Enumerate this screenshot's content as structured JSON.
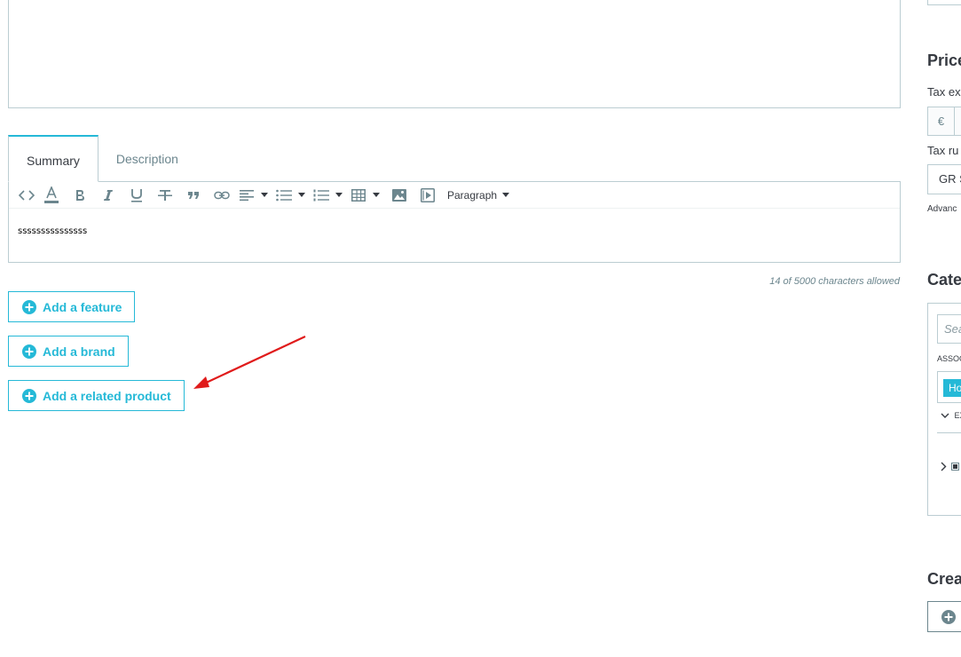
{
  "tabs": [
    {
      "label": "Summary",
      "active": true
    },
    {
      "label": "Description",
      "active": false
    }
  ],
  "toolbar": {
    "icons": [
      "code-icon",
      "text-color-icon",
      "bold-icon",
      "italic-icon",
      "underline-icon",
      "strikethrough-icon",
      "blockquote-icon",
      "link-icon",
      "align-icon",
      "bullet-list-icon",
      "numbered-list-icon",
      "table-icon",
      "image-icon",
      "media-icon"
    ],
    "paragraph_label": "Paragraph"
  },
  "editor": {
    "content": "sssssssssssssss"
  },
  "char_count": "14 of 5000 characters allowed",
  "buttons": {
    "add_feature": "Add a feature",
    "add_brand": "Add a brand",
    "add_related_product": "Add a related product"
  },
  "annotation": {
    "color": "#e01b1b"
  },
  "right_column": {
    "price_heading": "Price",
    "tax_excluded_label": "Tax ex",
    "currency_symbol": "€",
    "tax_rule_label": "Tax ru",
    "tax_rule_value": "GR S",
    "advanced_link": "Advanc",
    "categories_heading": "Cate",
    "category_search_placeholder": "Sea",
    "associated_label": "ASSOC",
    "category_tag": "Ho",
    "expand_label": "EX",
    "create_heading": "Crea"
  },
  "colors": {
    "accent": "#25b9d7",
    "border": "#bbcdd2",
    "muted": "#6c868e",
    "text": "#363a41"
  }
}
